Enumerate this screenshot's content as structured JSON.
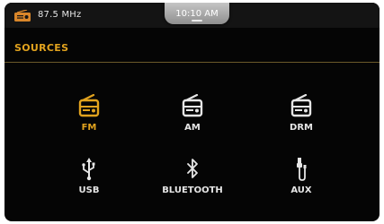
{
  "status_bar": {
    "frequency": "87.5 MHz",
    "time": "10:10 AM",
    "radio_icon": "radio-icon"
  },
  "header": {
    "title": "SOURCES"
  },
  "sources": [
    {
      "label": "FM",
      "icon": "radio-icon",
      "active": true
    },
    {
      "label": "AM",
      "icon": "radio-icon",
      "active": false
    },
    {
      "label": "DRM",
      "icon": "radio-icon",
      "active": false
    },
    {
      "label": "USB",
      "icon": "usb-icon",
      "active": false
    },
    {
      "label": "BLUETOOTH",
      "icon": "bluetooth-icon",
      "active": false
    },
    {
      "label": "AUX",
      "icon": "aux-cable-icon",
      "active": false
    }
  ],
  "colors": {
    "accent": "#e2a31e",
    "background": "#050505",
    "text": "#e6e6e6"
  }
}
